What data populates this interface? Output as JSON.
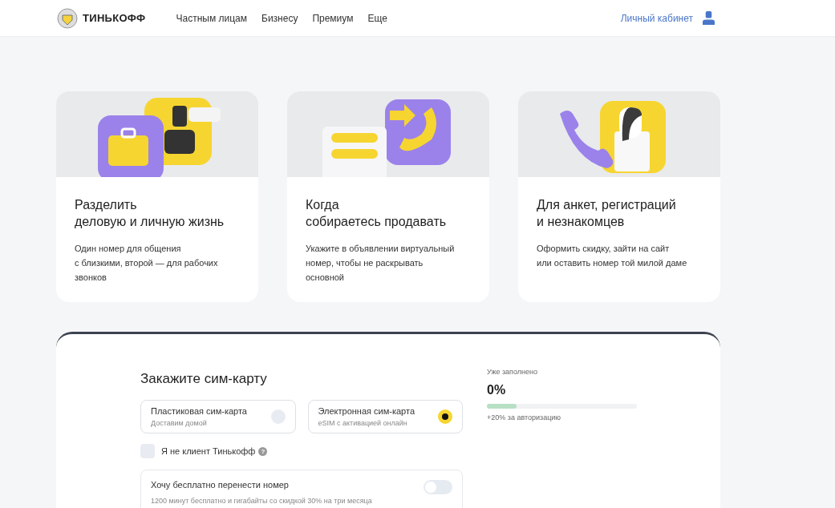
{
  "header": {
    "logo": "ТИНЬКОФФ",
    "nav": [
      {
        "label": "Частным лицам"
      },
      {
        "label": "Бизнесу"
      },
      {
        "label": "Премиум"
      },
      {
        "label": "Еще"
      }
    ],
    "account": "Личный кабинет"
  },
  "cards": [
    {
      "kind": "work",
      "title": "Разделить\nделовую и личную жизнь",
      "text": "Один номер для общения\nс близкими, второй — для рабочих\nзвонков"
    },
    {
      "kind": "sell",
      "title": "Когда\nсобираетесь продавать",
      "text": "Укажите в объявлении виртуальный\nномер, чтобы не раскрывать\nосновной"
    },
    {
      "kind": "forms",
      "title": "Для анкет, регистраций\nи незнакомцев",
      "text": "Оформить скидку, зайти на сайт\nили оставить номер той милой даме"
    }
  ],
  "order": {
    "title": "Закажите сим-карту",
    "options": [
      {
        "label": "Пластиковая сим-карта",
        "sub": "Доставим домой",
        "selected": false
      },
      {
        "label": "Электронная сим-карта",
        "sub": "eSIM с активацией онлайн",
        "selected": true
      }
    ],
    "not_client": {
      "label": "Я не клиент Тинькофф",
      "checked": false,
      "help": "?"
    },
    "transfer": {
      "label": "Хочу бесплатно перенести номер",
      "sub": "1200 минут бесплатно и гигабайты со скидкой 30% на три месяца",
      "on": false
    },
    "progress": {
      "caption": "Уже заполнено",
      "value": "0%",
      "level": 0.2,
      "hint": "+20% за авторизацию"
    }
  }
}
